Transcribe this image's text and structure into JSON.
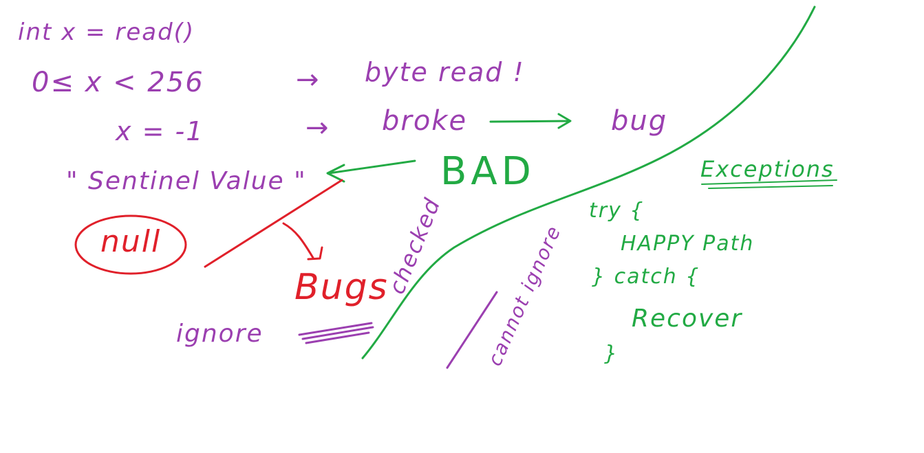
{
  "colors": {
    "purple_ink": "#9b3fb0",
    "green_ink": "#22aa44",
    "red_ink": "#e0202a",
    "background": "#ffffff"
  },
  "notes": {
    "line1": "int x =   read()",
    "line2_range": "0≤  x < 256",
    "line2_arrow": "→",
    "line2_result": "byte read !",
    "line3_value": "x = -1",
    "line3_arrow": "→",
    "line3_result": "broke",
    "line3_result_arrow": "⟶",
    "line3_bug": "bug",
    "sentinel": "\" Sentinel Value \"",
    "bad": "BAD",
    "null": "null",
    "bugs": "Bugs",
    "ignore": "ignore",
    "checked": "checked",
    "cannot_ignore": "cannot ignore",
    "exceptions": "Exceptions",
    "try_open": "try {",
    "happy_path": "HAPPY Path",
    "catch": "} catch {",
    "recover": "Recover",
    "close_brace": "}"
  }
}
